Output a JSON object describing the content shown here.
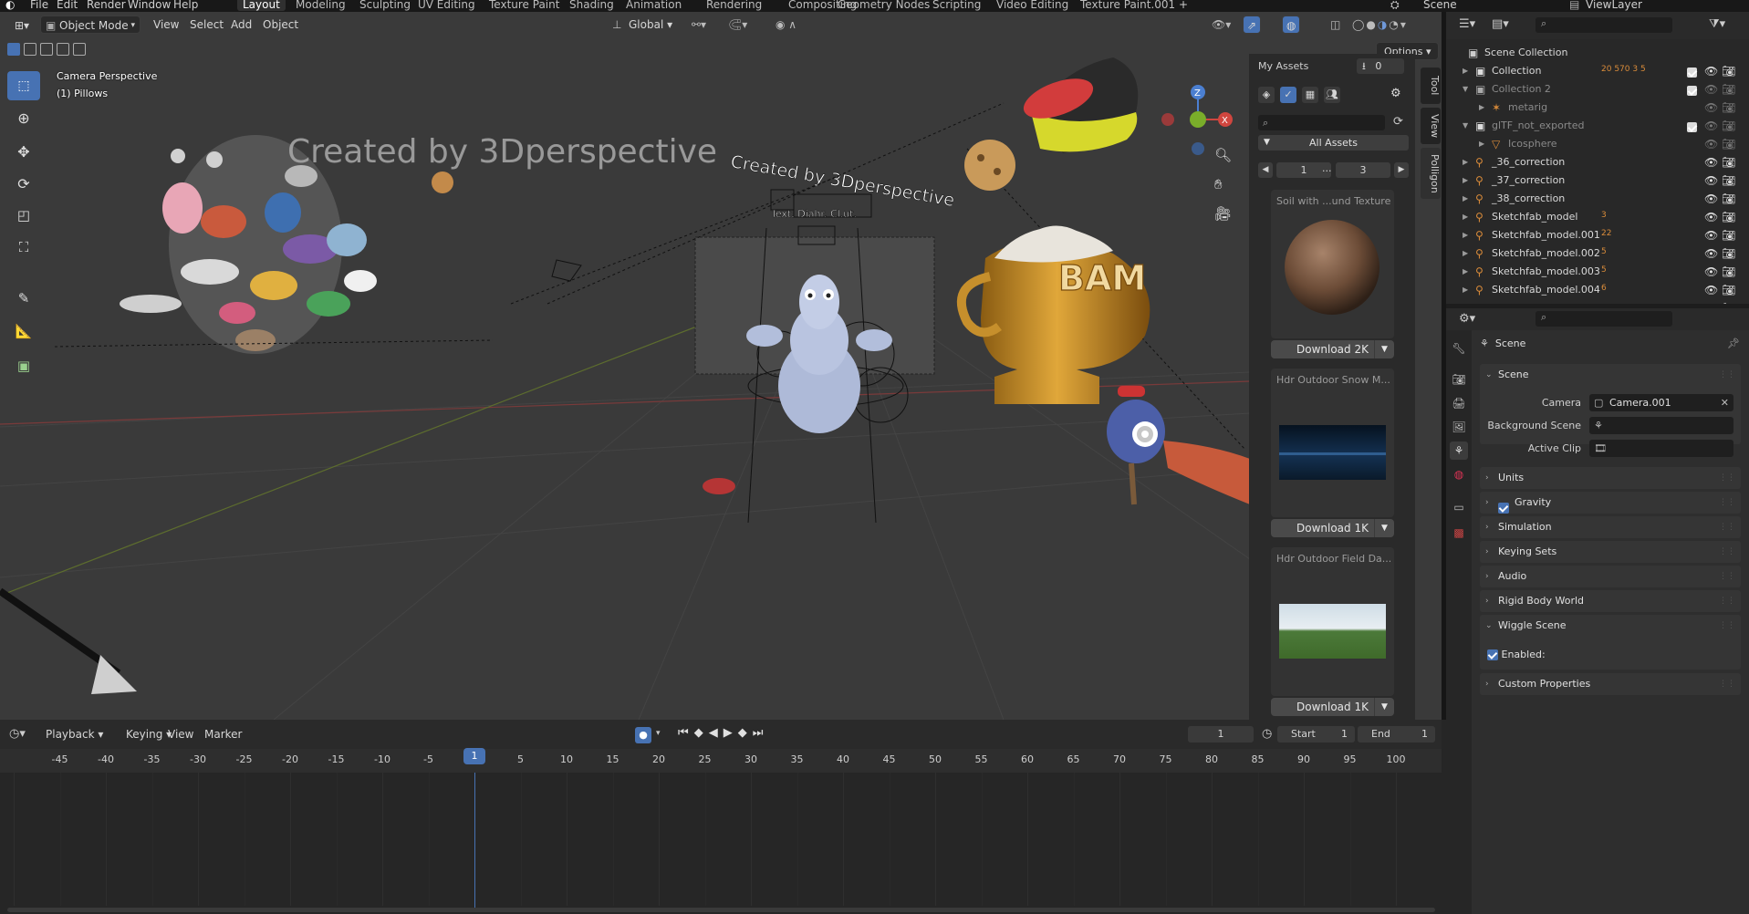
{
  "menu": {
    "file": "File",
    "edit": "Edit",
    "render": "Render",
    "window": "Window",
    "help": "Help"
  },
  "workspaces": [
    "Layout",
    "Modeling",
    "Sculpting",
    "UV Editing",
    "Texture Paint",
    "Shading",
    "Animation",
    "Rendering",
    "Compositing",
    "Geometry Nodes",
    "Scripting",
    "Video Editing",
    "Texture Paint.001"
  ],
  "active_workspace": "Layout",
  "scene_name": "Scene",
  "view_layer": "ViewLayer",
  "viewport_header": {
    "mode": "Object Mode",
    "view": "View",
    "select": "Select",
    "add": "Add",
    "object": "Object",
    "orientation": "Global",
    "options": "Options"
  },
  "viewport": {
    "camera_label": "Camera Perspective",
    "object_label": "(1) Pillows",
    "watermark": "Created by 3Dperspective",
    "watermark2": "Created by 3Dperspective",
    "bam_text": "BAM",
    "floating_label": "Text. Diahr. Cl.ut.",
    "gizmo": {
      "z": "Z",
      "x": "X",
      "y": "Y"
    }
  },
  "asset_panel": {
    "title": "My Assets",
    "download_count": "0",
    "all_assets": "All Assets",
    "page_current": "1",
    "page_ellipsis": "...",
    "page_total": "3",
    "cards": [
      {
        "title": "Soil with ...und Texture",
        "button": "Download 2K"
      },
      {
        "title": "Hdr Outdoor Snow M...",
        "button": "Download 1K"
      },
      {
        "title": "Hdr Outdoor Field Da...",
        "button": "Download 1K"
      }
    ],
    "side_tabs": [
      "Tool",
      "View",
      "Polligon"
    ]
  },
  "outliner": {
    "root": "Scene Collection",
    "rows": [
      {
        "label": "Collection",
        "badge": "20 570 3 5"
      },
      {
        "label": "Collection 2",
        "badge": ""
      },
      {
        "label": "metarig",
        "badge": ""
      },
      {
        "label": "glTF_not_exported",
        "badge": ""
      },
      {
        "label": "Icosphere",
        "badge": ""
      },
      {
        "label": "_36_correction",
        "badge": ""
      },
      {
        "label": "_37_correction",
        "badge": ""
      },
      {
        "label": "_38_correction",
        "badge": ""
      },
      {
        "label": "Sketchfab_model",
        "badge": "3"
      },
      {
        "label": "Sketchfab_model.001",
        "badge": "22"
      },
      {
        "label": "Sketchfab_model.002",
        "badge": "5"
      },
      {
        "label": "Sketchfab_model.003",
        "badge": "5"
      },
      {
        "label": "Sketchfab_model.004",
        "badge": "6"
      },
      {
        "label": "Sketchfab_model.005",
        "badge": ""
      }
    ]
  },
  "properties": {
    "header": "Scene",
    "scene_section": "Scene",
    "camera_label": "Camera",
    "camera_value": "Camera.001",
    "background_scene_label": "Background Scene",
    "active_clip_label": "Active Clip",
    "sections": [
      "Units",
      "Gravity",
      "Simulation",
      "Keying Sets",
      "Audio",
      "Rigid Body World",
      "Wiggle Scene"
    ],
    "enabled_label": "Enabled:",
    "custom_properties": "Custom Properties"
  },
  "timeline": {
    "playback": "Playback",
    "keying": "Keying",
    "view": "View",
    "marker": "Marker",
    "current_frame": "1",
    "start_label": "Start",
    "start_value": "1",
    "end_label": "End",
    "end_value": "1",
    "playhead": "1",
    "ticks": [
      "-45",
      "-40",
      "-35",
      "-30",
      "-25",
      "-20",
      "-15",
      "-10",
      "-5",
      "5",
      "10",
      "15",
      "20",
      "25",
      "30",
      "35",
      "40",
      "45",
      "50",
      "55",
      "60",
      "65",
      "70",
      "75",
      "80",
      "85",
      "90",
      "95",
      "100"
    ]
  },
  "colors": {
    "accent": "#4772b3",
    "viewport_bg": "#3a3a3a",
    "panel_bg": "#2e2e2e",
    "gizmo_z": "#4b7fd1",
    "gizmo_x": "#d0463f",
    "gizmo_y": "#7aad2a"
  }
}
